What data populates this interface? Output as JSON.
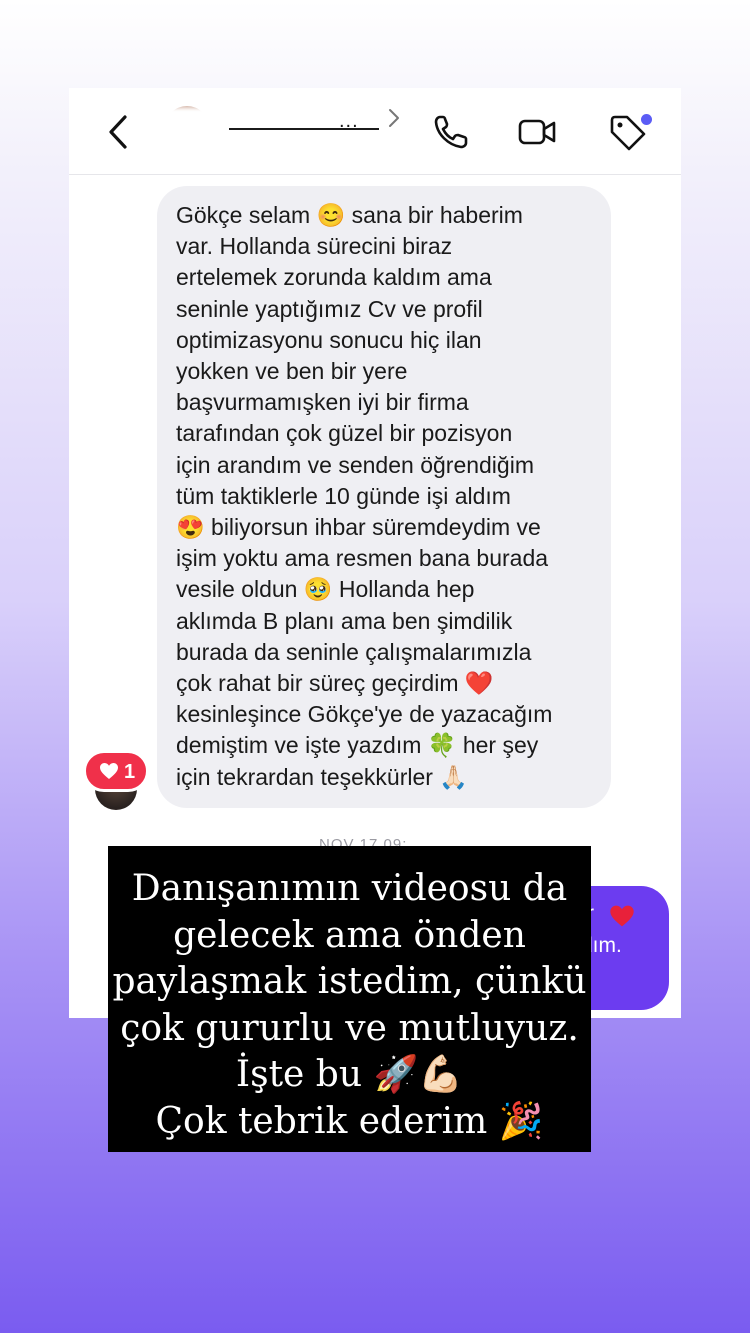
{
  "header": {
    "back_icon": "chevron-left-icon",
    "name_dots": "...",
    "call_icon": "phone-icon",
    "video_icon": "video-camera-icon",
    "tag_icon": "tag-icon",
    "tag_dot_color": "#5b5cf5"
  },
  "message": {
    "text": "Gökçe selam 😊 sana bir haberim\nvar. Hollanda sürecini biraz\nertelemek zorunda kaldım ama\nseninle yaptığımız Cv ve profil\noptimizasyonu sonucu hiç ilan\nyokken ve ben bir yere\nbaşvurmamışken iyi bir firma\ntarafından çok güzel bir pozisyon\niçin arandım ve senden öğrendiğim\ntüm taktiklerle 10 günde işi aldım\n😍 biliyorsun ihbar süremdeydim ve\nişim yoktu ama resmen bana burada\nvesile oldun 🥹 Hollanda hep\naklımda B planı ama ben şimdilik\nburada da seninle çalışmalarımızla\nçok rahat bir süreç geçirdim ❤️\nkesinleşince Gökçe'ye de yazacağım\ndemiştim ve işte yazdım 🍀 her şey\niçin tekrardan teşekkürler 🙏🏻",
    "like_count": "1",
    "like_color": "#f0304a"
  },
  "timestamp": "NOV 17 09:",
  "outgoing": {
    "line1": "r",
    "line2": "dım.",
    "color": "#6c3cf0"
  },
  "overlay": {
    "lines": [
      "Danışanımın videosu da",
      "gelecek ama önden",
      "paylaşmak istedim, çünkü",
      "çok gururlu ve mutluyuz.",
      "İşte bu 🚀💪🏻",
      "Çok tebrik ederim 🎉"
    ]
  }
}
